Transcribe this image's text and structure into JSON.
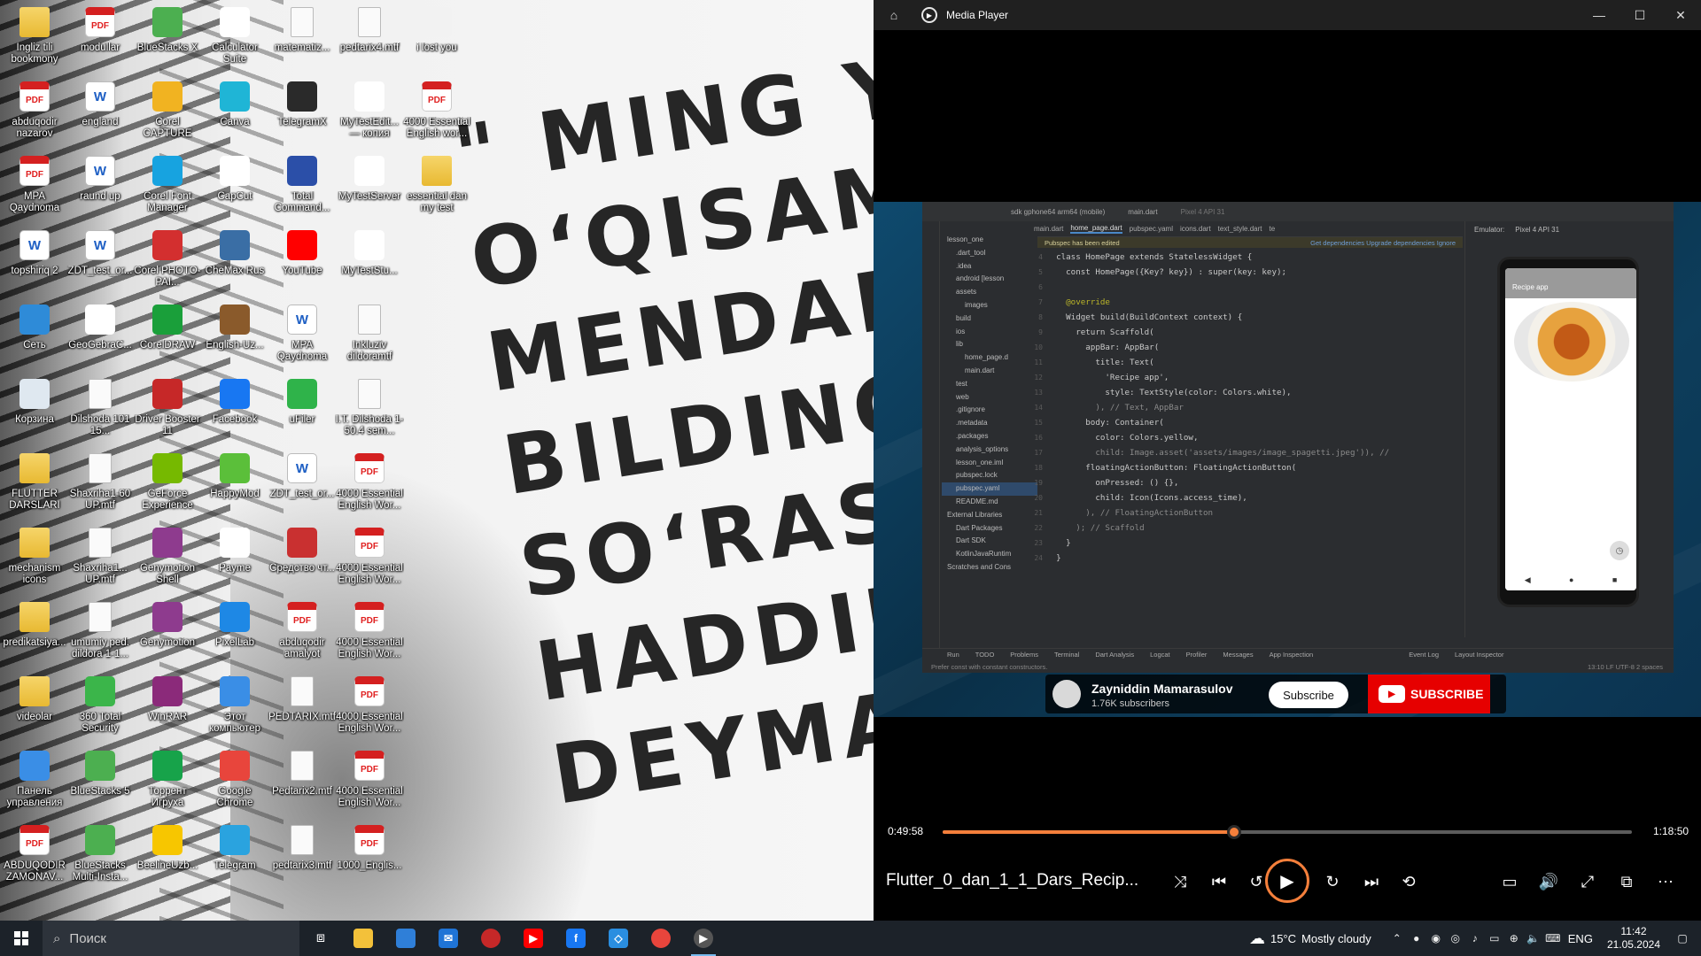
{
  "desktop": {
    "wallpaper_quote": [
      "\" MING Y",
      "O‘QISAM",
      "MENDAN «N",
      "BILDING?»",
      "SO‘RASA",
      "HADDIMNI",
      "DEYMA"
    ],
    "icons": [
      {
        "label": "Ingliz tili bookmony",
        "type": "folder"
      },
      {
        "label": "modullar",
        "type": "pdf"
      },
      {
        "label": "BlueStacks X",
        "type": "app",
        "color": "#4caf50"
      },
      {
        "label": "Calculator Suite",
        "type": "app",
        "color": "#ffffff"
      },
      {
        "label": "matematiz...",
        "type": "file"
      },
      {
        "label": "pedtarix4.mtf",
        "type": "file"
      },
      {
        "label": "i lost you",
        "type": "app",
        "color": "#f2f2f2"
      },
      {
        "label": "abduqodir nazarov",
        "type": "pdf"
      },
      {
        "label": "england",
        "type": "word"
      },
      {
        "label": "Corel CAPTURE",
        "type": "app",
        "color": "#f1b321"
      },
      {
        "label": "Canva",
        "type": "app",
        "color": "#1fb5d6"
      },
      {
        "label": "TelegramX",
        "type": "app",
        "color": "#2a2a2a"
      },
      {
        "label": "MyTestEdit... — копия",
        "type": "app",
        "color": "#ffffff"
      },
      {
        "label": "4000 Essential English wor...",
        "type": "pdf"
      },
      {
        "label": "MPA Qaydnoma",
        "type": "pdf"
      },
      {
        "label": "raund up",
        "type": "word"
      },
      {
        "label": "Corel Font Manager",
        "type": "app",
        "color": "#17a3e0"
      },
      {
        "label": "CapCut",
        "type": "app",
        "color": "#ffffff"
      },
      {
        "label": "Total Command...",
        "type": "app",
        "color": "#2b4fa8"
      },
      {
        "label": "MyTestServer",
        "type": "app",
        "color": "#ffffff"
      },
      {
        "label": "essential dan my test",
        "type": "folder"
      },
      {
        "label": "topshiriq 2",
        "type": "word"
      },
      {
        "label": "ZDT_test_or...",
        "type": "word"
      },
      {
        "label": "Corel PHOTO-PAI...",
        "type": "app",
        "color": "#d32f2f"
      },
      {
        "label": "CheMax Rus",
        "type": "app",
        "color": "#3a6ea5"
      },
      {
        "label": "YouTube",
        "type": "app",
        "color": "#ff0000"
      },
      {
        "label": "MyTestStu...",
        "type": "app",
        "color": "#ffffff"
      },
      {
        "label": "Сеть",
        "type": "app",
        "color": "#2e8bd8"
      },
      {
        "label": "GeoGebraC...",
        "type": "app",
        "color": "#ffffff"
      },
      {
        "label": "CorelDRAW",
        "type": "app",
        "color": "#1a9f3a"
      },
      {
        "label": "English-Uz...",
        "type": "app",
        "color": "#8a5a2b"
      },
      {
        "label": "MPA Qaydnoma",
        "type": "word"
      },
      {
        "label": "Inkluziv dildoramtf",
        "type": "file"
      },
      {
        "label": "Корзина",
        "type": "app",
        "color": "#dfe8f0"
      },
      {
        "label": "Dilshoda 101 15...",
        "type": "file"
      },
      {
        "label": "Driver Booster 11",
        "type": "app",
        "color": "#c62828"
      },
      {
        "label": "Facebook",
        "type": "app",
        "color": "#1877f2"
      },
      {
        "label": "uFiler",
        "type": "app",
        "color": "#2fb34a"
      },
      {
        "label": "I.T. Dilshoda 1-50.4 sem...",
        "type": "file"
      },
      {
        "label": "FLUTTER DARSLARI",
        "type": "folder"
      },
      {
        "label": "Shaxriha1-60 UP.mtf",
        "type": "file"
      },
      {
        "label": "GeForce Experience",
        "type": "app",
        "color": "#76b900"
      },
      {
        "label": "HappyMod",
        "type": "app",
        "color": "#5bbf3a"
      },
      {
        "label": "ZDT_test_or...",
        "type": "word"
      },
      {
        "label": "4000 Essential English Wor...",
        "type": "pdf"
      },
      {
        "label": "mechanism icons",
        "type": "folder"
      },
      {
        "label": "Shaxriha1... UP.mtf",
        "type": "file"
      },
      {
        "label": "Genymotion Shell",
        "type": "app",
        "color": "#8e3b8e"
      },
      {
        "label": "Payme",
        "type": "app",
        "color": "#ffffff"
      },
      {
        "label": "Средство чт...",
        "type": "app",
        "color": "#c93030"
      },
      {
        "label": "4000 Essential English Wor...",
        "type": "pdf"
      },
      {
        "label": "predikatsiya...",
        "type": "folder"
      },
      {
        "label": "umumiy ped. dildora 1-1...",
        "type": "file"
      },
      {
        "label": "Genymotion",
        "type": "app",
        "color": "#8e3b8e"
      },
      {
        "label": "PixelLab",
        "type": "app",
        "color": "#1e88e5"
      },
      {
        "label": "abduqodir amalyot",
        "type": "pdf"
      },
      {
        "label": "4000 Essential English Wor...",
        "type": "pdf"
      },
      {
        "label": "videolar",
        "type": "folder"
      },
      {
        "label": "360 Total Security",
        "type": "app",
        "color": "#3bb54a"
      },
      {
        "label": "WinRAR",
        "type": "app",
        "color": "#8b2a7a"
      },
      {
        "label": "Этот компьютер",
        "type": "app",
        "color": "#3a8ee6"
      },
      {
        "label": "PEDTARIX.mtf",
        "type": "file"
      },
      {
        "label": "4000 Essential English Wor...",
        "type": "pdf"
      },
      {
        "label": "Панель управления",
        "type": "app",
        "color": "#3a8ee6"
      },
      {
        "label": "BlueStacks 5",
        "type": "app",
        "color": "#4caf50"
      },
      {
        "label": "Торрент Игруха",
        "type": "app",
        "color": "#17a34a"
      },
      {
        "label": "Google Chrome",
        "type": "app",
        "color": "#e8453c"
      },
      {
        "label": "Pedtarix2.mtf",
        "type": "file"
      },
      {
        "label": "4000 Essential English Wor...",
        "type": "pdf"
      },
      {
        "label": "ABDUQODIR ZAMONAV...",
        "type": "pdf"
      },
      {
        "label": "BlueStacks Multi-Insta...",
        "type": "app",
        "color": "#4caf50"
      },
      {
        "label": "BeelineUzb...",
        "type": "app",
        "color": "#f7c600"
      },
      {
        "label": "Telegram",
        "type": "app",
        "color": "#2aa3df"
      },
      {
        "label": "pedtarix3.mtf",
        "type": "file"
      },
      {
        "label": "1000_Englis...",
        "type": "pdf"
      }
    ]
  },
  "player": {
    "title": "Media Player",
    "file_title": "Flutter_0_dan_1_1_Dars_Recip...",
    "time_elapsed": "0:49:58",
    "time_total": "1:18:50",
    "progress_fraction": 0.4226,
    "accent": "#f47f3b",
    "controls": {
      "shuffle": "⤨",
      "prev": "⏮",
      "rewind": "↺",
      "play": "▶",
      "forward": "↻",
      "next": "⏭",
      "repeat": "⟲",
      "captions": "▭",
      "volume": "🔊",
      "fullscreen": "⤢",
      "miniplayer": "⧉",
      "more": "⋯"
    }
  },
  "video": {
    "ide": {
      "device": "sdk gphone64 arm64 (mobile)",
      "run_config": "main.dart",
      "emulator_label": "Pixel 4 API 31",
      "tabs": [
        "main.dart",
        "home_page.dart",
        "pubspec.yaml",
        "icons.dart",
        "text_style.dart",
        "te"
      ],
      "notice": "Pubspec has been edited",
      "notice_actions": "Get dependencies   Upgrade dependencies   Ignore",
      "project_tree": [
        "lesson_one",
        ".dart_tool",
        ".idea",
        "android [lesson",
        "assets",
        "images",
        "build",
        "ios",
        "lib",
        "home_page.d",
        "main.dart",
        "test",
        "web",
        ".gitignore",
        ".metadata",
        ".packages",
        "analysis_options",
        "lesson_one.iml",
        "pubspec.lock",
        "pubspec.yaml",
        "README.md",
        "External Libraries",
        "Dart Packages",
        "Dart SDK",
        "KotlinJavaRuntim",
        "Scratches and Cons"
      ],
      "line_numbers": [
        "4",
        "5",
        "6",
        "7",
        "8",
        "9",
        "10",
        "11",
        "12",
        "13",
        "14",
        "15",
        "16",
        "17",
        "18",
        "19",
        "20",
        "21",
        "22",
        "23",
        "24"
      ],
      "code": [
        "  class HomePage extends StatelessWidget {",
        "    const HomePage({Key? key}) : super(key: key);",
        "",
        "    @override",
        "    Widget build(BuildContext context) {",
        "      return Scaffold(",
        "        appBar: AppBar(",
        "          title: Text(",
        "            'Recipe app',",
        "            style: TextStyle(color: Colors.white),",
        "          ), // Text, AppBar",
        "        body: Container(",
        "          color: Colors.yellow,",
        "          child: Image.asset('assets/images/image_spagetti.jpeg')), //",
        "        floatingActionButton: FloatingActionButton(",
        "          onPressed: () {},",
        "          child: Icon(Icons.access_time),",
        "        ), // FloatingActionButton",
        "      ); // Scaffold",
        "    }",
        "  }"
      ],
      "app_title": "Recipe app",
      "bottom_tools": [
        "Run",
        "TODO",
        "Problems",
        "Terminal",
        "Dart Analysis",
        "Logcat",
        "Profiler",
        "Messages",
        "App Inspection",
        "Event Log",
        "Layout Inspector"
      ],
      "status_left": "Prefer const with constant constructors.",
      "status_right": "13:10  LF  UTF-8  2 spaces"
    },
    "youtube": {
      "channel": "Zayniddin Mamarasulov",
      "subscribers": "1.76K subscribers",
      "subscribe_label": "Subscribe",
      "big_subscribe_label": "SUBSCRIBE"
    }
  },
  "taskbar": {
    "search_placeholder": "Поиск",
    "weather_temp": "15°C",
    "weather_text": "Mostly cloudy",
    "language": "ENG",
    "time": "11:42",
    "date": "21.05.2024",
    "apps": [
      {
        "name": "file-explorer",
        "color": "#f3c13a"
      },
      {
        "name": "microsoft-store",
        "color": "#2f7fd8"
      },
      {
        "name": "mail",
        "color": "#1f74d6"
      },
      {
        "name": "driver-booster",
        "color": "#c62828"
      },
      {
        "name": "youtube",
        "color": "#ff0000"
      },
      {
        "name": "facebook",
        "color": "#1877f2"
      },
      {
        "name": "vs-code",
        "color": "#2a8ee0"
      },
      {
        "name": "chrome",
        "color": "#e8453c"
      },
      {
        "name": "media-player",
        "color": "#555555"
      }
    ]
  }
}
